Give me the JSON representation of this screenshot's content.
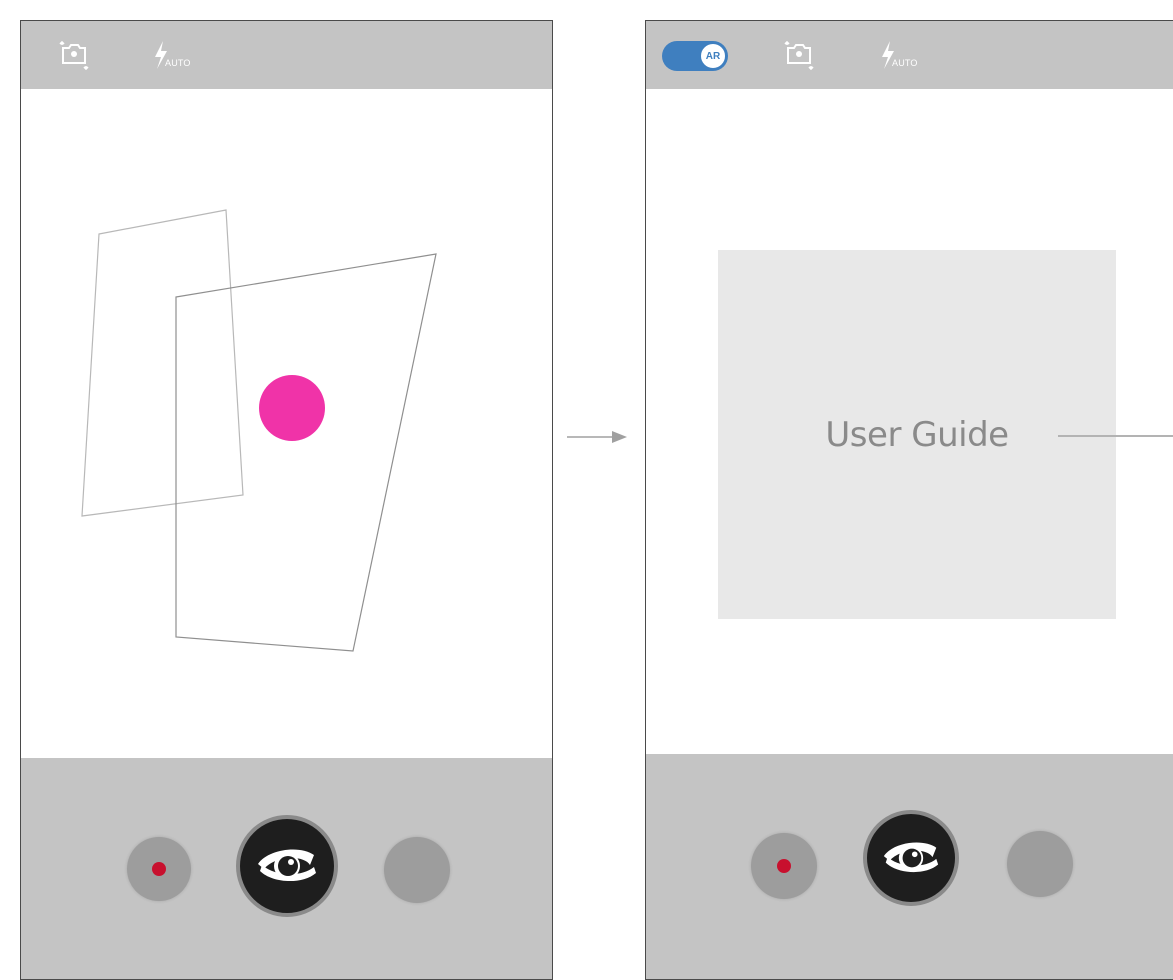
{
  "screens": [
    {
      "id": "camera-view",
      "topbar": {
        "flash_mode": "AUTO"
      },
      "viewfinder": {
        "marker_color": "#f033a8"
      },
      "controls": {
        "record": "record-button",
        "shutter": "eye-shutter",
        "gallery": "gallery-button"
      }
    },
    {
      "id": "ar-view",
      "topbar": {
        "ar_toggle_label": "AR",
        "ar_enabled": true,
        "flash_mode": "AUTO"
      },
      "content": {
        "guide_title": "User Guide"
      },
      "controls": {
        "record": "record-button",
        "shutter": "eye-shutter",
        "gallery": "gallery-button"
      }
    }
  ],
  "colors": {
    "bar_gray": "#c4c4c4",
    "toggle_blue": "#3f7fbf",
    "record_red": "#c8102e",
    "card_gray": "#e8e8e8",
    "marker_pink": "#f033a8"
  },
  "icons": [
    "switch-camera-icon",
    "flash-auto-icon",
    "eye-icon",
    "arrow-right-icon"
  ]
}
